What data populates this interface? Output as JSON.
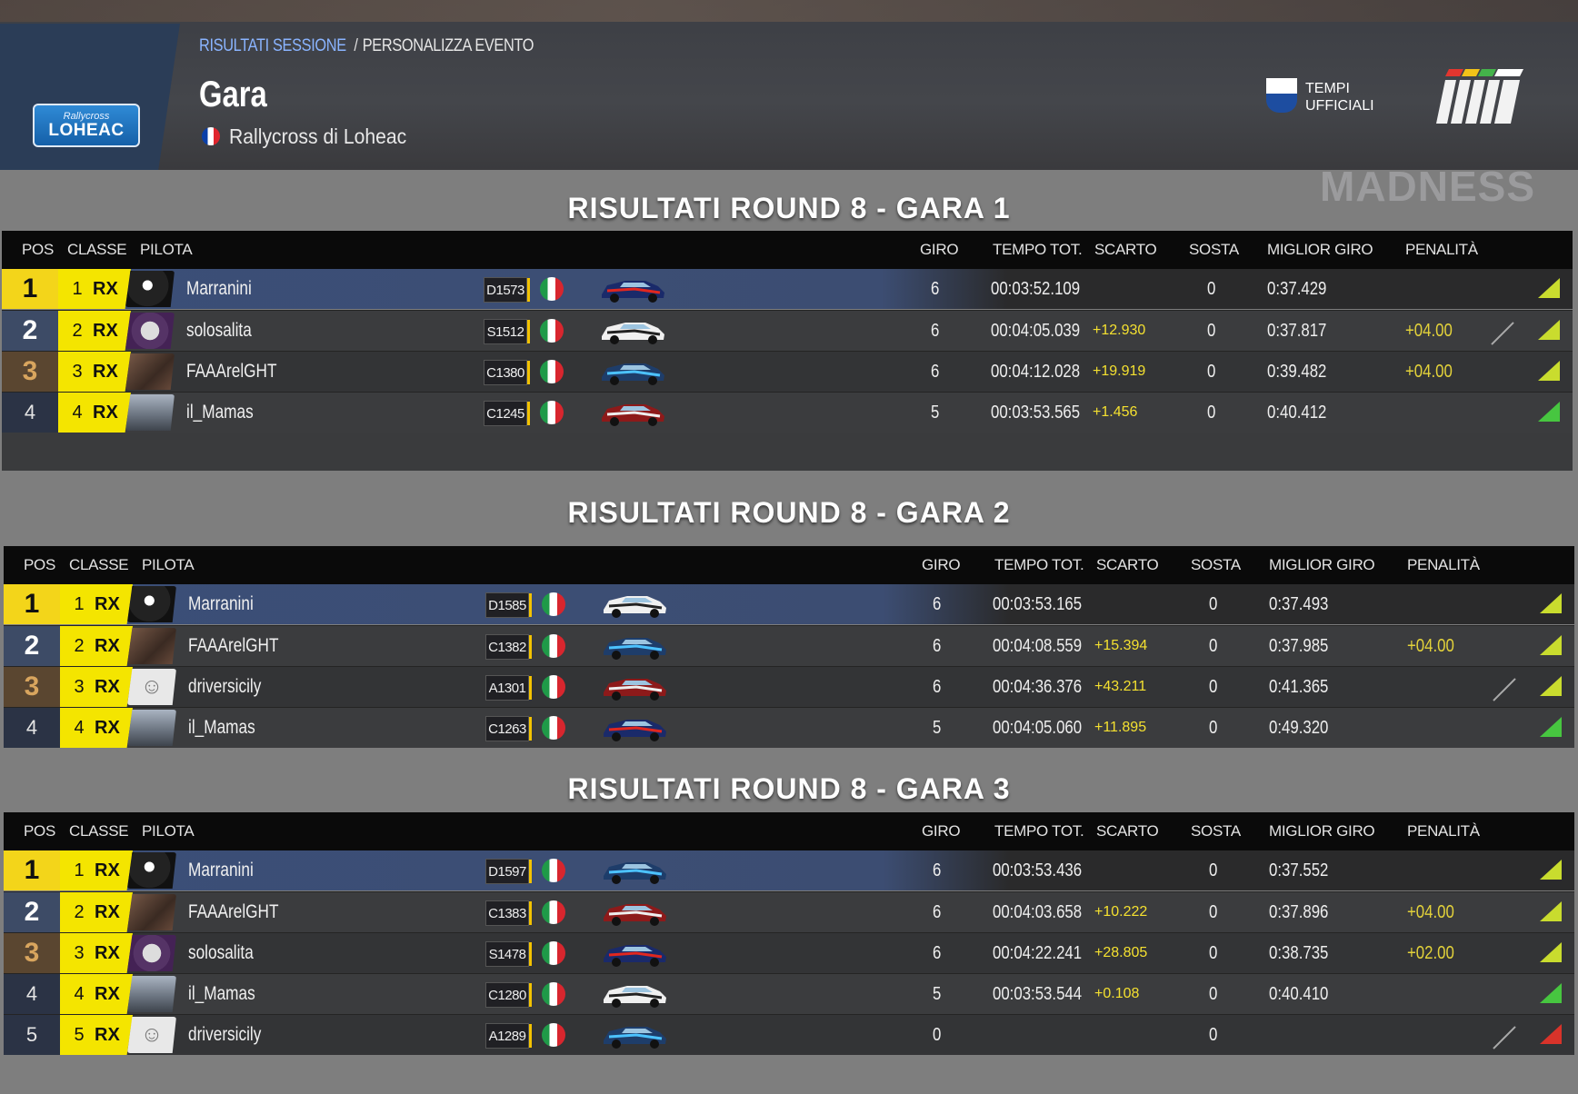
{
  "header": {
    "breadcrumb_active": "RISULTATI SESSIONE",
    "breadcrumb_sep": "/",
    "breadcrumb_next": "PERSONALIZZA EVENTO",
    "title": "Gara",
    "event": "Rallycross di Loheac",
    "logo_top": "Rallycross",
    "logo_bottom": "LOHEAC",
    "timing_line1": "TEMPI",
    "timing_line2": "UFFICIALI",
    "bg_sign": "MADNESS"
  },
  "columns": {
    "pos": "POS",
    "classe": "CLASSE",
    "pilota": "PILOTA",
    "giro": "GIRO",
    "tempo": "TEMPO TOT.",
    "scarto": "SCARTO",
    "sosta": "SOSTA",
    "miglior": "MIGLIOR GIRO",
    "penalita": "PENALITÀ"
  },
  "races": [
    {
      "title": "RISULTATI ROUND 8 - GARA 1",
      "rows": [
        {
          "pos": "1",
          "class_pos": "1",
          "class": "RX",
          "driver": "Marranini",
          "license": "D1573",
          "laps": "6",
          "total": "00:03:52.109",
          "gap": "",
          "stops": "0",
          "best": "0:37.429",
          "penalty": "",
          "flag": false,
          "status": "yellow"
        },
        {
          "pos": "2",
          "class_pos": "2",
          "class": "RX",
          "driver": "solosalita",
          "license": "S1512",
          "laps": "6",
          "total": "00:04:05.039",
          "gap": "+12.930",
          "stops": "0",
          "best": "0:37.817",
          "penalty": "+04.00",
          "flag": true,
          "status": "yellow"
        },
        {
          "pos": "3",
          "class_pos": "3",
          "class": "RX",
          "driver": "FAAArelGHT",
          "license": "C1380",
          "laps": "6",
          "total": "00:04:12.028",
          "gap": "+19.919",
          "stops": "0",
          "best": "0:39.482",
          "penalty": "+04.00",
          "flag": false,
          "status": "yellow"
        },
        {
          "pos": "4",
          "class_pos": "4",
          "class": "RX",
          "driver": "il_Mamas",
          "license": "C1245",
          "laps": "5",
          "total": "00:03:53.565",
          "gap": "+1.456",
          "stops": "0",
          "best": "0:40.412",
          "penalty": "",
          "flag": false,
          "status": "green"
        }
      ]
    },
    {
      "title": "RISULTATI ROUND 8 - GARA 2",
      "rows": [
        {
          "pos": "1",
          "class_pos": "1",
          "class": "RX",
          "driver": "Marranini",
          "license": "D1585",
          "laps": "6",
          "total": "00:03:53.165",
          "gap": "",
          "stops": "0",
          "best": "0:37.493",
          "penalty": "",
          "flag": false,
          "status": "yellow"
        },
        {
          "pos": "2",
          "class_pos": "2",
          "class": "RX",
          "driver": "FAAArelGHT",
          "license": "C1382",
          "laps": "6",
          "total": "00:04:08.559",
          "gap": "+15.394",
          "stops": "0",
          "best": "0:37.985",
          "penalty": "+04.00",
          "flag": false,
          "status": "yellow"
        },
        {
          "pos": "3",
          "class_pos": "3",
          "class": "RX",
          "driver": "driversicily",
          "license": "A1301",
          "laps": "6",
          "total": "00:04:36.376",
          "gap": "+43.211",
          "stops": "0",
          "best": "0:41.365",
          "penalty": "",
          "flag": true,
          "status": "yellow"
        },
        {
          "pos": "4",
          "class_pos": "4",
          "class": "RX",
          "driver": "il_Mamas",
          "license": "C1263",
          "laps": "5",
          "total": "00:04:05.060",
          "gap": "+11.895",
          "stops": "0",
          "best": "0:49.320",
          "penalty": "",
          "flag": false,
          "status": "green"
        }
      ]
    },
    {
      "title": "RISULTATI ROUND 8 - GARA 3",
      "rows": [
        {
          "pos": "1",
          "class_pos": "1",
          "class": "RX",
          "driver": "Marranini",
          "license": "D1597",
          "laps": "6",
          "total": "00:03:53.436",
          "gap": "",
          "stops": "0",
          "best": "0:37.552",
          "penalty": "",
          "flag": false,
          "status": "yellow"
        },
        {
          "pos": "2",
          "class_pos": "2",
          "class": "RX",
          "driver": "FAAArelGHT",
          "license": "C1383",
          "laps": "6",
          "total": "00:04:03.658",
          "gap": "+10.222",
          "stops": "0",
          "best": "0:37.896",
          "penalty": "+04.00",
          "flag": false,
          "status": "yellow"
        },
        {
          "pos": "3",
          "class_pos": "3",
          "class": "RX",
          "driver": "solosalita",
          "license": "S1478",
          "laps": "6",
          "total": "00:04:22.241",
          "gap": "+28.805",
          "stops": "0",
          "best": "0:38.735",
          "penalty": "+02.00",
          "flag": false,
          "status": "yellow"
        },
        {
          "pos": "4",
          "class_pos": "4",
          "class": "RX",
          "driver": "il_Mamas",
          "license": "C1280",
          "laps": "5",
          "total": "00:03:53.544",
          "gap": "+0.108",
          "stops": "0",
          "best": "0:40.410",
          "penalty": "",
          "flag": false,
          "status": "green"
        },
        {
          "pos": "5",
          "class_pos": "5",
          "class": "RX",
          "driver": "driversicily",
          "license": "A1289",
          "laps": "0",
          "total": "",
          "gap": "",
          "stops": "0",
          "best": "",
          "penalty": "",
          "flag": true,
          "status": "red"
        }
      ]
    }
  ]
}
